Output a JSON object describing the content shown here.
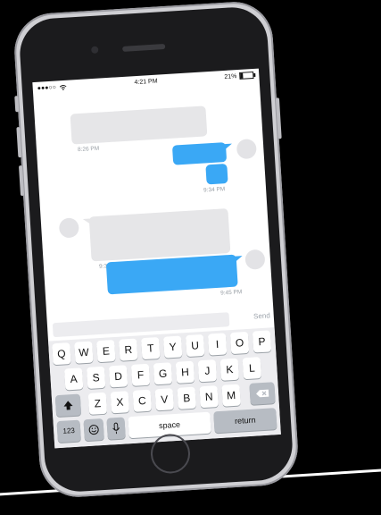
{
  "status_bar": {
    "signal": "●●●○○",
    "time": "4:21 PM",
    "battery_text": "21%",
    "battery_level": 0.21,
    "wifi_icon": "wifi-icon"
  },
  "messages": [
    {
      "direction": "received",
      "timestamp": "8:26 PM"
    },
    {
      "direction": "sent",
      "timestamp": "9:34 PM"
    },
    {
      "direction": "received",
      "timestamp": "9:38 PM"
    },
    {
      "direction": "sent",
      "timestamp": "9:45 PM"
    }
  ],
  "input": {
    "placeholder": "",
    "send_label": "Send"
  },
  "keyboard": {
    "row1": [
      "Q",
      "W",
      "E",
      "R",
      "T",
      "Y",
      "U",
      "I",
      "O",
      "P"
    ],
    "row2": [
      "A",
      "S",
      "D",
      "F",
      "G",
      "H",
      "J",
      "K",
      "L"
    ],
    "row3": [
      "Z",
      "X",
      "C",
      "V",
      "B",
      "N",
      "M"
    ],
    "numbers_label": "123",
    "space_label": "space",
    "return_label": "return",
    "shift_icon": "shift-icon",
    "delete_icon": "delete-icon",
    "emoji_icon": "emoji-icon",
    "mic_icon": "microphone-icon"
  },
  "colors": {
    "sent_bubble": "#3aa8f5",
    "received_bubble": "#e6e6e8"
  }
}
